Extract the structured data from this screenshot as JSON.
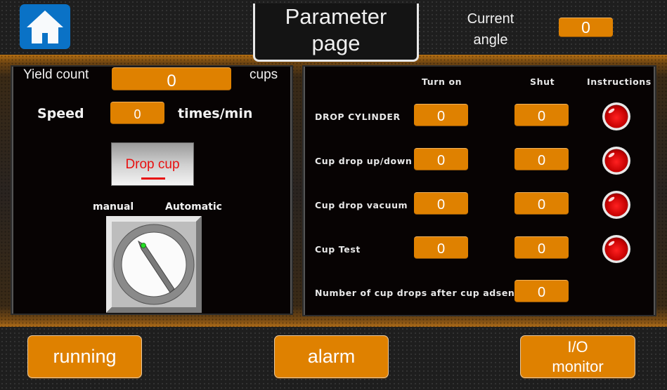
{
  "header": {
    "title_line1": "Parameter",
    "title_line2": "page",
    "current_angle_label_line1": "Current",
    "current_angle_label_line2": "angle",
    "current_angle_value": "0",
    "home_icon": "home-icon"
  },
  "left_panel": {
    "yield_count_label": "Yield count",
    "yield_count_value": "0",
    "yield_count_unit": "cups",
    "speed_label": "Speed",
    "speed_value": "0",
    "speed_unit": "times/min",
    "drop_cup_button": "Drop cup",
    "mode_manual_label": "manual",
    "mode_automatic_label": "Automatic",
    "mode_switch_state": "manual"
  },
  "right_panel": {
    "columns": [
      "Turn on",
      "Shut",
      "Instructions"
    ],
    "rows": [
      {
        "label": "DROP CYLINDER",
        "turn_on": "0",
        "shut": "0",
        "indicator": "red"
      },
      {
        "label": "Cup drop up/down",
        "turn_on": "0",
        "shut": "0",
        "indicator": "red"
      },
      {
        "label": "Cup drop vacuum",
        "turn_on": "0",
        "shut": "0",
        "indicator": "red"
      },
      {
        "label": "Cup Test",
        "turn_on": "0",
        "shut": "0",
        "indicator": "red"
      }
    ],
    "cup_drops_after_absence_label": "Number of cup drops after cup adsence",
    "cup_drops_after_absence_value": "0"
  },
  "footer": {
    "running_button": "running",
    "alarm_button": "alarm",
    "io_monitor_line1": "I/O",
    "io_monitor_line2": "monitor"
  },
  "colors": {
    "accent_orange": "#df8100",
    "home_blue": "#0a72c6",
    "indicator_red": "#d40000",
    "drop_cup_text": "#e81010"
  }
}
